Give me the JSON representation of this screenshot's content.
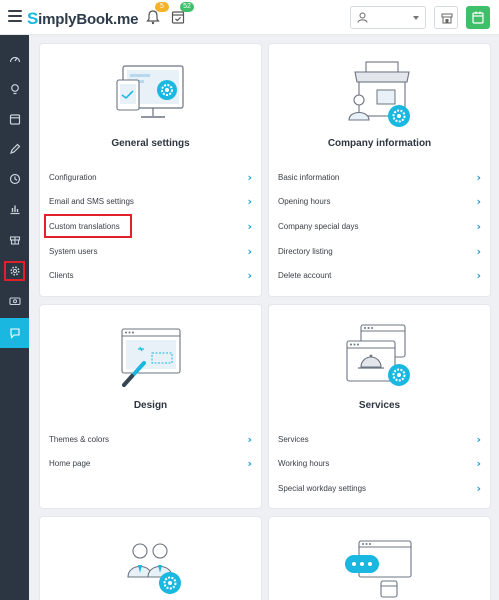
{
  "header": {
    "logo_text": "SimplyBook.me",
    "notifications_count": "5",
    "bookings_count": "52"
  },
  "sidebar": {
    "items": [
      "dashboard-icon",
      "bulb-icon",
      "calendar-icon",
      "pencil-icon",
      "clock-icon",
      "chart-icon",
      "gift-icon",
      "gear-icon",
      "money-icon",
      "chat-icon"
    ]
  },
  "cards": {
    "general": {
      "title": "General settings",
      "items": [
        "Configuration",
        "Email and SMS settings",
        "Custom translations",
        "System users",
        "Clients"
      ]
    },
    "company": {
      "title": "Company information",
      "items": [
        "Basic information",
        "Opening hours",
        "Company special days",
        "Directory listing",
        "Delete account"
      ]
    },
    "design": {
      "title": "Design",
      "items": [
        "Themes & colors",
        "Home page"
      ]
    },
    "services": {
      "title": "Services",
      "items": [
        "Services",
        "Working hours",
        "Special workday settings"
      ]
    }
  },
  "colors": {
    "accent": "#1ab8e0",
    "highlight": "#e0202a",
    "sidebar": "#2b3642",
    "success": "#3fbf6a",
    "badge": "#f5b32a"
  }
}
